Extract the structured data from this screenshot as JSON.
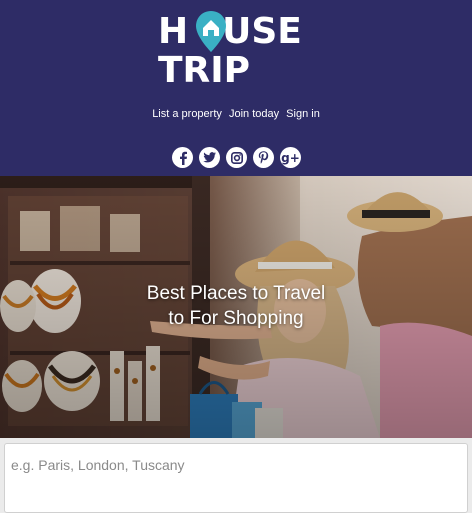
{
  "brand": {
    "logo_line1": "HOUSE",
    "logo_line2": "TRIP",
    "accent_color": "#3ab0c4",
    "header_color": "#2e2c66"
  },
  "nav": {
    "list_property": "List a property",
    "join": "Join today",
    "sign_in": "Sign in"
  },
  "social": {
    "icons": [
      "facebook-icon",
      "twitter-icon",
      "instagram-icon",
      "pinterest-icon",
      "google-plus-icon"
    ]
  },
  "hero": {
    "title_line1": "Best Places to Travel",
    "title_line2": "to For Shopping"
  },
  "search": {
    "placeholder": "e.g. Paris, London, Tuscany"
  }
}
